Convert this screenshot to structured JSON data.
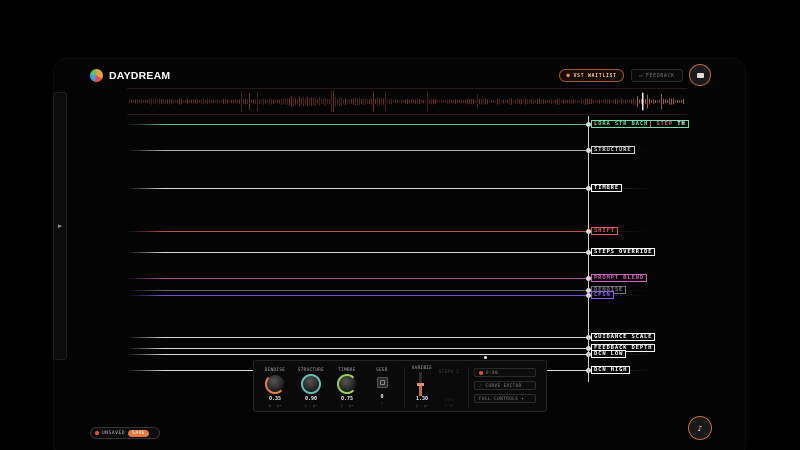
{
  "app": {
    "name": "DAYDREAM"
  },
  "header": {
    "waitlist_label": "VST WAITLIST",
    "feedback_label": "FEEDBACK"
  },
  "params": [
    {
      "label": "LORA STR BACH",
      "extra": "STEP",
      "extra2": "TH",
      "color": "#6fe0a0",
      "extra_color": "#e05a8a"
    },
    {
      "label": "STRUCTURE",
      "color": "#cfcfcf"
    },
    {
      "label": "TIMBRE",
      "color": "#ffffff"
    },
    {
      "label": "SHIFT",
      "color": "#e05a5a"
    },
    {
      "label": "STEPS OVERRIDE",
      "color": "#ffffff"
    },
    {
      "label": "PROMPT BLEND",
      "color": "#d060c0"
    },
    {
      "label": "DENOISE",
      "color": "#777777"
    },
    {
      "label": "CFSN",
      "color": "#8a60ff"
    },
    {
      "label": "GUIDANCE SCALE",
      "color": "#ffffff"
    },
    {
      "label": "FEEDBACK DEPTH",
      "color": "#ffffff"
    },
    {
      "label": "DCN LOW",
      "color": "#ffffff"
    },
    {
      "label": "DCN HIGH",
      "color": "#ffffff"
    }
  ],
  "controls": {
    "knobs": [
      {
        "label": "DENOISE",
        "value": "0.35",
        "sub": "0 · p•",
        "color": "#e08050",
        "level": 0.35
      },
      {
        "label": "STRUCTURE",
        "value": "0.90",
        "sub": "1 · p•",
        "color": "#60c0b0",
        "level": 0.9
      },
      {
        "label": "TIMBRE",
        "value": "0.75",
        "sub": "2 · p•",
        "color": "#9ad050",
        "level": 0.75
      }
    ],
    "seed": {
      "label": "SEED",
      "value": "0",
      "sub": "7"
    },
    "variance": {
      "label": "VARIBIE",
      "value": "1.30",
      "sub": "2 · p•",
      "level": 0.45
    },
    "faint_col": {
      "label": "STEPS 2",
      "sub_label": "TEMPO",
      "sub_value": "0.00"
    },
    "buttons": {
      "rec": "0:00",
      "curve": "CURVE EDITOR",
      "full": "FULL CONTROLS ▾"
    }
  },
  "status": {
    "unsaved_label": "UNSAVED",
    "save_label": "SAVE"
  },
  "icons": {
    "menu": "menu-icon",
    "fab": "music-note-icon",
    "side": "chevron-right-icon"
  }
}
